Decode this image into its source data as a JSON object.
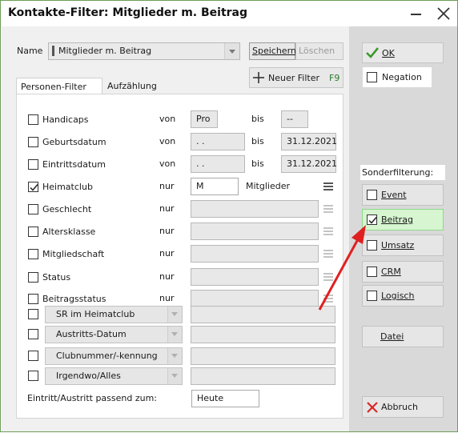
{
  "window": {
    "title": "Kontakte-Filter: Mitglieder m. Beitrag"
  },
  "name_row": {
    "label": "Name",
    "value": "Mitglieder m. Beitrag",
    "save_label": "Speichern",
    "delete_label": "Löschen",
    "new_filter_label": "Neuer Filter",
    "new_filter_shortcut": "F9"
  },
  "tabs": [
    {
      "label": "Personen-Filter",
      "active": true
    },
    {
      "label": "Aufzählung",
      "active": false
    }
  ],
  "filters": [
    {
      "label": "Handicaps",
      "checked": false,
      "op": "von",
      "v1": "Pro",
      "mid": "bis",
      "v2": "--"
    },
    {
      "label": "Geburtsdatum",
      "checked": false,
      "op": "von",
      "v1": ". .",
      "mid": "bis",
      "v2": "31.12.2021"
    },
    {
      "label": "Eintrittsdatum",
      "checked": false,
      "op": "von",
      "v1": ". .",
      "mid": "bis",
      "v2": "31.12.2021"
    },
    {
      "label": "Heimatclub",
      "checked": true,
      "op": "nur",
      "v1": "M",
      "mid": "Mitglieder"
    },
    {
      "label": "Geschlecht",
      "checked": false,
      "op": "nur",
      "v1": ""
    },
    {
      "label": "Altersklasse",
      "checked": false,
      "op": "nur",
      "v1": ""
    },
    {
      "label": "Mitgliedschaft",
      "checked": false,
      "op": "nur",
      "v1": ""
    },
    {
      "label": "Status",
      "checked": false,
      "op": "nur",
      "v1": ""
    },
    {
      "label": "Beitragsstatus",
      "checked": false,
      "op": "nur",
      "v1": ""
    }
  ],
  "select_filters": [
    {
      "label": "SR im Heimatclub",
      "checked": false,
      "value": ""
    },
    {
      "label": "Austritts-Datum",
      "checked": false,
      "value": ""
    },
    {
      "label": "Clubnummer/-kennung",
      "checked": false,
      "value": ""
    },
    {
      "label": "Irgendwo/Alles",
      "checked": false,
      "value": ""
    }
  ],
  "footer": {
    "label": "Eintritt/Austritt passend zum:",
    "value": "Heute"
  },
  "right": {
    "ok_label": "OK",
    "negation_label": "Negation",
    "negation_checked": false,
    "special_label": "Sonderfilterung:",
    "special": [
      {
        "label": "Event",
        "checked": false
      },
      {
        "label": "Beitrag",
        "checked": true
      },
      {
        "label": "Umsatz",
        "checked": false
      },
      {
        "label": "CRM",
        "checked": false
      },
      {
        "label": "Logisch",
        "checked": false
      }
    ],
    "file_label": "Datei",
    "cancel_label": "Abbruch"
  },
  "colors": {
    "ok_check": "#3a9a2a",
    "cancel_x": "#d62828",
    "arrow": "#e02020",
    "selected_bg": "#d6f5d0"
  }
}
